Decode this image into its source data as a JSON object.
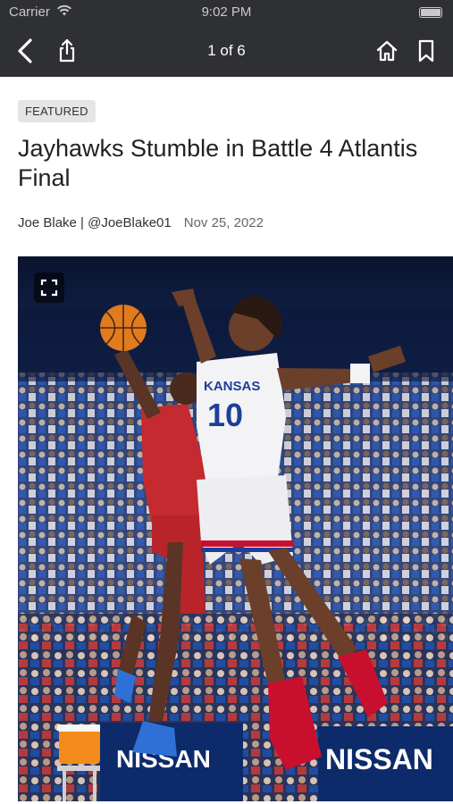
{
  "status_bar": {
    "carrier": "Carrier",
    "time": "9:02 PM"
  },
  "nav": {
    "back_icon": "chevron-left",
    "share_icon": "share",
    "counter": "1 of 6",
    "home_icon": "home",
    "bookmark_icon": "bookmark"
  },
  "article": {
    "badge": "FEATURED",
    "headline": "Jayhawks Stumble in Battle 4 Atlantis Final",
    "author": "Joe Blake | @JoeBlake01",
    "date": "Nov 25, 2022"
  },
  "hero_image": {
    "expand_icon": "expand",
    "jersey_text": "KANSAS",
    "jersey_number": "10",
    "sponsor_text_left": "NISSAN",
    "sponsor_text_right": "NISSAN"
  },
  "colors": {
    "nav_background": "#2f3034",
    "badge_background": "#e5e5e5",
    "headline": "#222222"
  }
}
